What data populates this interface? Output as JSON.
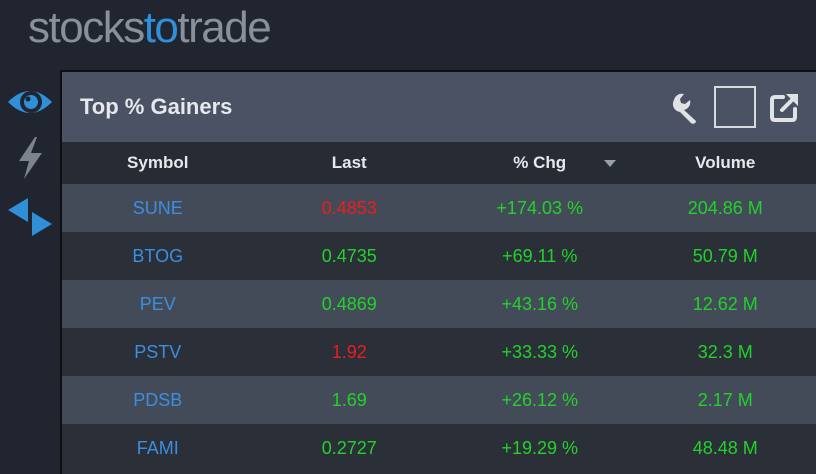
{
  "brand": {
    "part1": "stocks",
    "part2": "to",
    "part3": "trade"
  },
  "sidebar": {
    "items": [
      {
        "icon": "eye-icon"
      },
      {
        "icon": "lightning-icon"
      },
      {
        "icon": "arrows-icon"
      }
    ]
  },
  "panel": {
    "title": "Top % Gainers",
    "columns": {
      "symbol": "Symbol",
      "last": "Last",
      "chg": "% Chg",
      "volume": "Volume"
    },
    "rows": [
      {
        "symbol": "SUNE",
        "last": "0.4853",
        "chg": "+174.03 %",
        "volume": "204.86 M"
      },
      {
        "symbol": "BTOG",
        "last": "0.4735",
        "chg": "+69.11 %",
        "volume": "50.79 M"
      },
      {
        "symbol": "PEV",
        "last": "0.4869",
        "chg": "+43.16 %",
        "volume": "12.62 M"
      },
      {
        "symbol": "PSTV",
        "last": "1.92",
        "chg": "+33.33 %",
        "volume": "32.3 M"
      },
      {
        "symbol": "PDSB",
        "last": "1.69",
        "chg": "+26.12 %",
        "volume": "2.17 M"
      },
      {
        "symbol": "FAMI",
        "last": "0.2727",
        "chg": "+19.29 %",
        "volume": "48.48 M"
      }
    ]
  },
  "colors": {
    "accent_blue": "#3b8fe0",
    "positive_green": "#22d22a",
    "negative_red": "#ee1c1c",
    "last_price_colors": [
      "#ee1c1c",
      "#22d22a",
      "#22d22a",
      "#ee1c1c",
      "#22d22a",
      "#22d22a"
    ]
  }
}
